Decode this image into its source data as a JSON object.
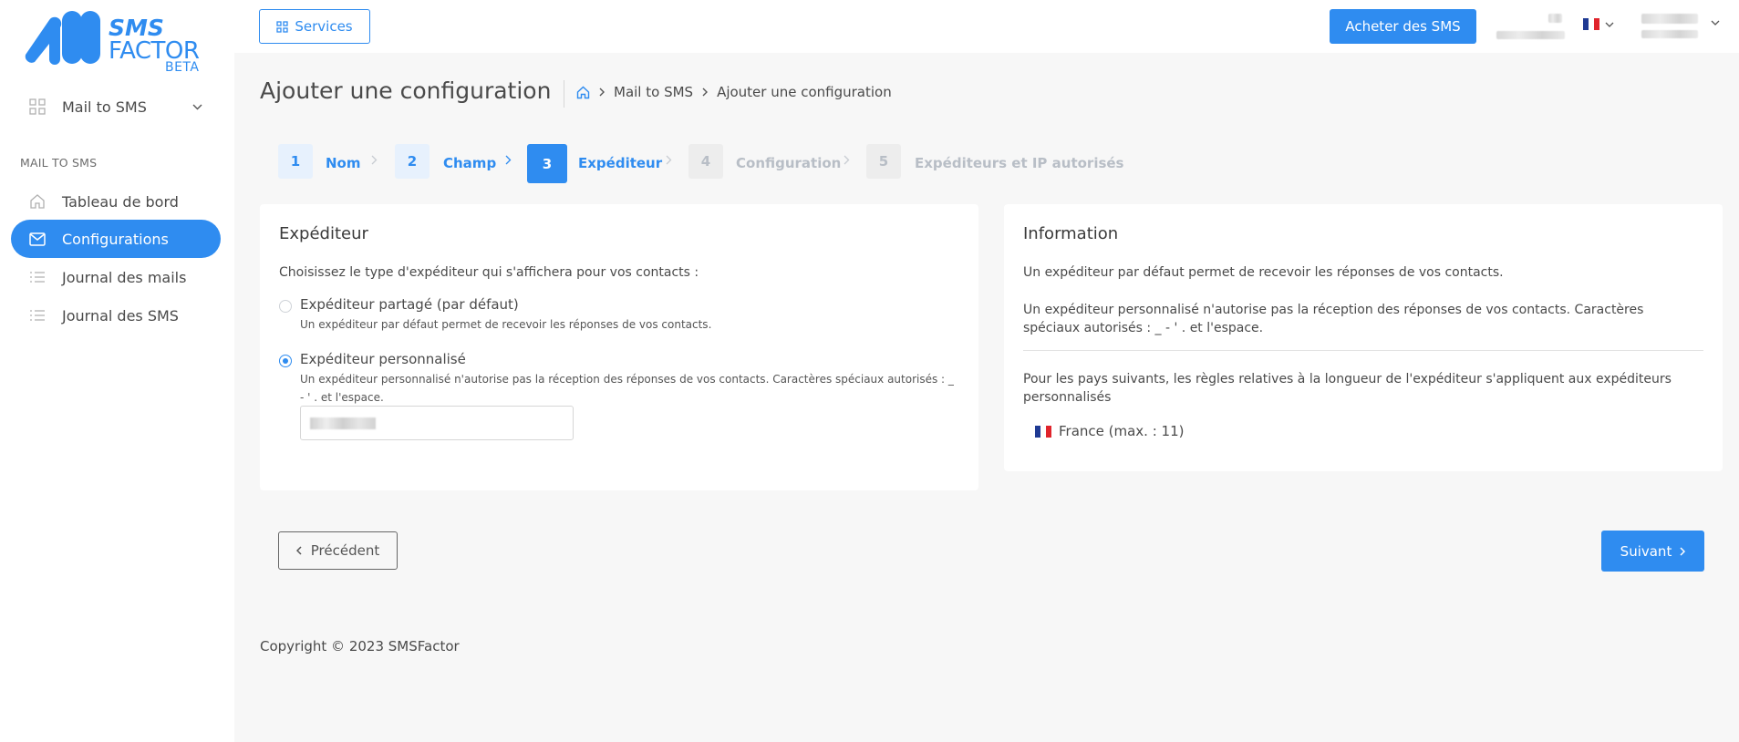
{
  "brand": {
    "line1": "SMS",
    "line2": "FACTOR",
    "line3": "BETA",
    "color": "#2f8cf0"
  },
  "sidebar": {
    "top_item": {
      "label": "Mail to SMS",
      "icon": "grid-icon"
    },
    "section_title": "MAIL TO SMS",
    "items": [
      {
        "label": "Tableau de bord",
        "icon": "home-icon",
        "active": false
      },
      {
        "label": "Configurations",
        "icon": "mail-icon",
        "active": true
      },
      {
        "label": "Journal des mails",
        "icon": "list-icon",
        "active": false
      },
      {
        "label": "Journal des SMS",
        "icon": "list-icon",
        "active": false
      }
    ]
  },
  "topbar": {
    "services_label": "Services",
    "buy_label": "Acheter des SMS"
  },
  "page": {
    "title": "Ajouter une configuration",
    "breadcrumb": [
      "Mail to SMS",
      "Ajouter une configuration"
    ]
  },
  "steps": [
    {
      "num": "1",
      "label": "Nom",
      "state": "done"
    },
    {
      "num": "2",
      "label": "Champ",
      "state": "done"
    },
    {
      "num": "3",
      "label": "Expéditeur",
      "state": "active"
    },
    {
      "num": "4",
      "label": "Configuration",
      "state": "pending"
    },
    {
      "num": "5",
      "label": "Expéditeurs et IP autorisés",
      "state": "pending"
    }
  ],
  "sender_card": {
    "title": "Expéditeur",
    "intro": "Choisissez le type d'expéditeur qui s'affichera pour vos contacts :",
    "options": [
      {
        "title": "Expéditeur partagé (par défaut)",
        "desc": "Un expéditeur par défaut permet de recevoir les réponses de vos contacts.",
        "checked": false
      },
      {
        "title": "Expéditeur personnalisé",
        "desc_line1": "Un expéditeur personnalisé n'autorise pas la réception des réponses de vos contacts. Caractères spéciaux autorisés : _",
        "desc_line2": "- ' . et l'espace.",
        "checked": true
      }
    ]
  },
  "info_card": {
    "title": "Information",
    "p1": "Un expéditeur par défaut permet de recevoir les réponses de vos contacts.",
    "p2_line1": "Un expéditeur personnalisé n'autorise pas la réception des réponses de vos contacts. Caractères",
    "p2_line2": "spéciaux autorisés : _ - ' . et l'espace.",
    "p3_line1": "Pour les pays suivants, les règles relatives à la longueur de l'expéditeur s'appliquent aux expéditeurs",
    "p3_line2": "personnalisés",
    "country": "France (max. : 11)"
  },
  "nav": {
    "prev_label": "Précédent",
    "next_label": "Suivant"
  },
  "footer": {
    "copyright": "Copyright © 2023 SMSFactor"
  },
  "colors": {
    "accent": "#2f8cf0",
    "step_done_bg": "#e7f1fd",
    "step_pending_bg": "#ededed",
    "step_pending_text": "#b8bec6"
  }
}
